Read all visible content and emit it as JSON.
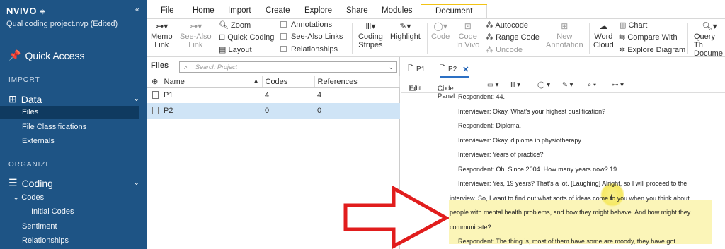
{
  "app": {
    "logo": "NVIVO",
    "project": "Qual coding project.nvp (Edited)",
    "collapse_icon": "«"
  },
  "sidebar": {
    "quick_access": "Quick Access",
    "import_label": "IMPORT",
    "data_label": "Data",
    "data_items": [
      "Files",
      "File Classifications",
      "Externals"
    ],
    "organize_label": "ORGANIZE",
    "coding_label": "Coding",
    "codes_label": "Codes",
    "initial_codes": "Initial Codes",
    "sentiment": "Sentiment",
    "relationships": "Relationships"
  },
  "ribbon_tabs": [
    "File",
    "Home",
    "Import",
    "Create",
    "Explore",
    "Share",
    "Modules",
    "Document"
  ],
  "ribbon": {
    "memo_link": [
      "Memo",
      "Link"
    ],
    "see_also_link": [
      "See-Also",
      "Link"
    ],
    "zoom": "Zoom",
    "quick_coding": "Quick Coding",
    "layout": "Layout",
    "annotations": "Annotations",
    "see_also_links": "See-Also Links",
    "relationships": "Relationships",
    "coding_stripes": [
      "Coding",
      "Stripes"
    ],
    "highlight": "Highlight",
    "code": "Code",
    "code_in_vivo": [
      "Code",
      "In Vivo"
    ],
    "autocode": "Autocode",
    "range_code": "Range Code",
    "uncode": "Uncode",
    "new_annotation": [
      "New",
      "Annotation"
    ],
    "word_cloud": [
      "Word",
      "Cloud"
    ],
    "chart": "Chart",
    "compare_with": "Compare With",
    "explore_diagram": "Explore Diagram",
    "query_this_document": [
      "Query Th",
      "Docume"
    ]
  },
  "files": {
    "title": "Files",
    "search_placeholder": "Search Project",
    "columns": [
      "Name",
      "Codes",
      "References"
    ],
    "rows": [
      {
        "name": "P1",
        "codes": "4",
        "references": "4"
      },
      {
        "name": "P2",
        "codes": "0",
        "references": "0"
      }
    ]
  },
  "document": {
    "tabs": [
      "P1",
      "P2"
    ],
    "edit_label": "Edit",
    "code_panel_label": "Code Panel",
    "lines": [
      "Respondent: 44.",
      "Interviewer: Okay. What's your highest qualification?",
      "Respondent: Diploma.",
      "Interviewer: Okay, diploma in physiotherapy.",
      "Interviewer: Years of practice?",
      "Respondent: Oh. Since 2004. How many years now? 19",
      "Interviewer: Yes, 19 years? That's a lot. [Laughing] Alright, so I will proceed to the",
      "interview. So, I want to find out what sorts of ideas come to you when you think about",
      "people with mental health problems, and how they might behave. And how might they",
      "communicate?",
      "Respondent: The thing is, most of them have some are moody, they have got"
    ]
  },
  "colors": {
    "sidebar_bg": "#1e5485",
    "sidebar_active": "#0f3a60",
    "selection": "#cfe4f6",
    "tab_accent": "#f2c314",
    "highlight": "#fbf5b8",
    "arrow": "#e11d1d"
  }
}
